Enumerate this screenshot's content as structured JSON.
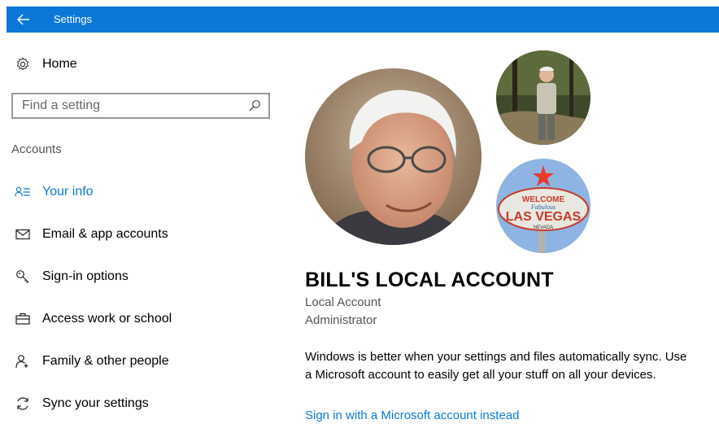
{
  "window": {
    "title": "Settings"
  },
  "nav": {
    "home_label": "Home",
    "search": {
      "placeholder": "Find a setting"
    },
    "section_heading": "Accounts",
    "items": [
      {
        "label": "Your info",
        "icon": "your-info-icon",
        "active": true
      },
      {
        "label": "Email & app accounts",
        "icon": "mail-icon",
        "active": false
      },
      {
        "label": "Sign-in options",
        "icon": "key-icon",
        "active": false
      },
      {
        "label": "Access work or school",
        "icon": "briefcase-icon",
        "active": false
      },
      {
        "label": "Family & other people",
        "icon": "person-add-icon",
        "active": false
      },
      {
        "label": "Sync your settings",
        "icon": "sync-icon",
        "active": false
      }
    ]
  },
  "main": {
    "account_name": "BILL'S LOCAL ACCOUNT",
    "account_type": "Local Account",
    "account_role": "Administrator",
    "description": "Windows is better when your settings and files automatically sync. Use a Microsoft account to easily get all your stuff on all your devices.",
    "sign_in_link": "Sign in with a Microsoft account instead",
    "avatar_sign_text": {
      "top": "WELCOME",
      "middle": "Fabulous",
      "main": "LAS VEGAS",
      "bottom": "NEVADA"
    }
  },
  "colors": {
    "accent": "#0b78d7",
    "titlebar": "#0b78d7",
    "secondary_text": "#555555"
  }
}
